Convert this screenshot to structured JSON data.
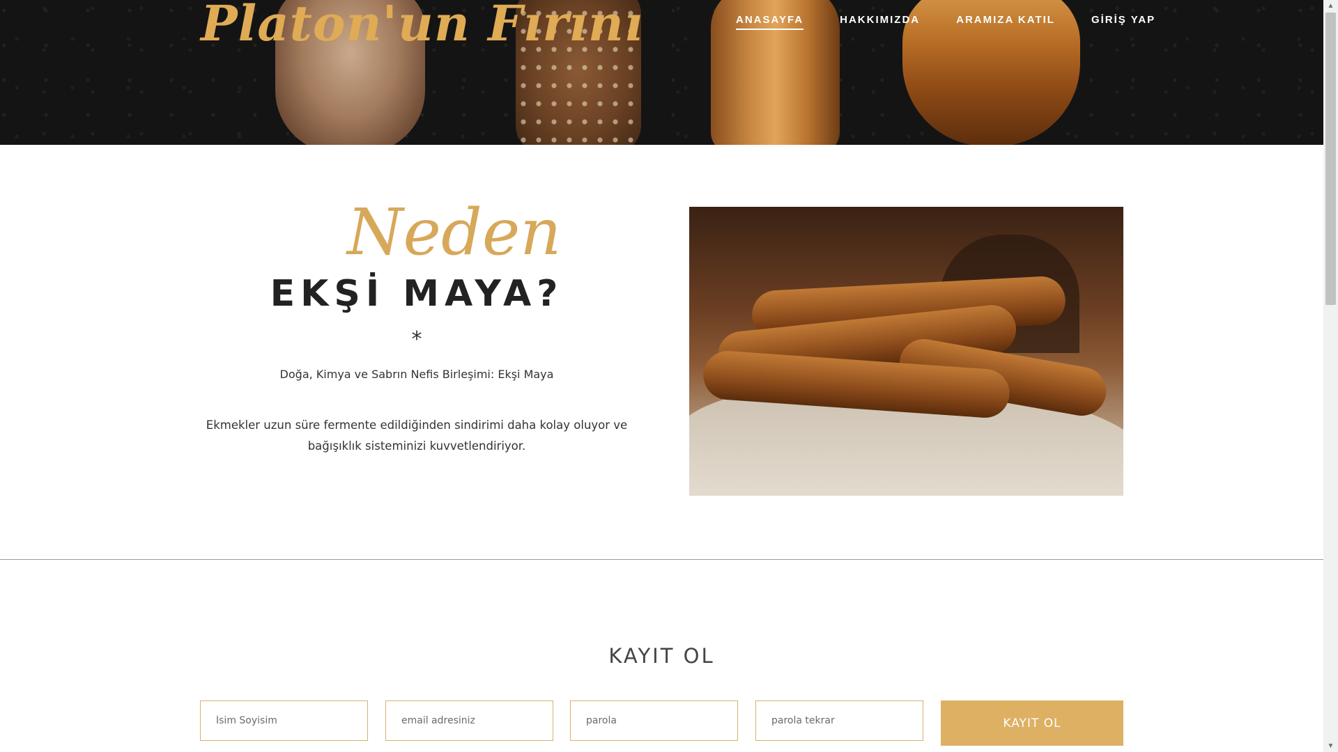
{
  "brand": {
    "logo_text": "Platon'un Fırını",
    "accent_color": "#ddb063"
  },
  "nav": {
    "items": [
      {
        "label": "ANASAYFA",
        "active": true
      },
      {
        "label": "HAKKIMIZDA",
        "active": false
      },
      {
        "label": "ARAMIZA KATIL",
        "active": false
      },
      {
        "label": "GİRİŞ YAP",
        "active": false
      }
    ]
  },
  "why": {
    "script_word": "Neden",
    "headline": "EKŞİ MAYA?",
    "ornament": "*",
    "subtitle": "Doğa, Kimya ve Sabrın Nefis Birleşimi: Ekşi Maya",
    "body": "Ekmekler uzun süre fermente edildiğinden sindirimi daha kolay oluyor ve bağışıklık sisteminizi kuvvetlendiriyor."
  },
  "signup": {
    "title": "KAYIT OL",
    "fields": [
      {
        "placeholder": "İsim Soyisim",
        "value": ""
      },
      {
        "placeholder": "email adresiniz",
        "value": ""
      },
      {
        "placeholder": "parola",
        "value": ""
      },
      {
        "placeholder": "parola tekrar",
        "value": ""
      }
    ],
    "submit_label": "KAYIT OL"
  },
  "icons": {
    "scroll_up": "chevron-up-icon",
    "scroll_down": "chevron-down-icon"
  }
}
